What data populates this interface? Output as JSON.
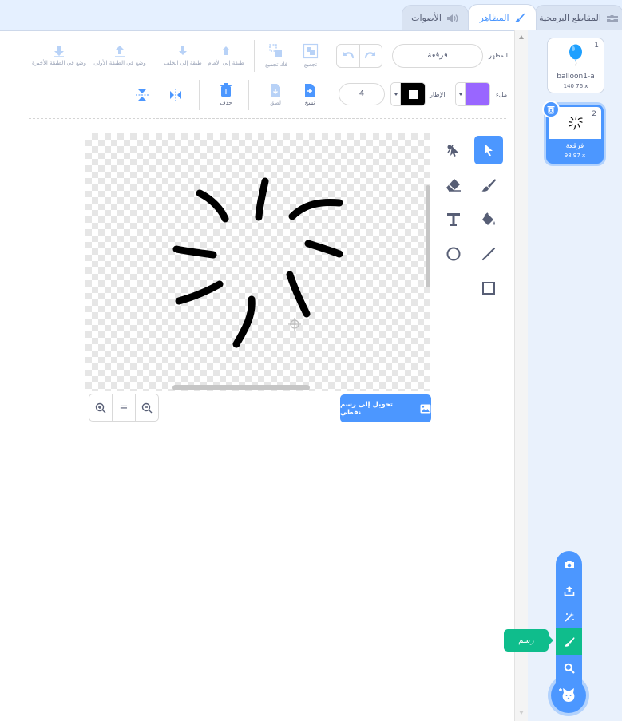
{
  "tabs": {
    "code": "المقاطع البرمجية",
    "costumes": "المظاهر",
    "sounds": "الأصوات"
  },
  "toolbar": {
    "costume_label": "المظهر",
    "costume_name": "فرقعة",
    "group": "تجميع",
    "ungroup": "فك تجميع",
    "forward": "طبقة إلى الأمام",
    "backward": "طبقة إلى الخلف",
    "front": "وضع في الطبقة الأولى",
    "back": "وضع في الطبقة الأخيرة",
    "fill_label": "ملء",
    "outline_label": "الإطار",
    "outline_width": "4",
    "copy": "نسخ",
    "paste": "لصق",
    "delete": "حذف",
    "fill_color": "#9966ff",
    "outline_color": "#000000"
  },
  "canvas": {
    "convert_button": "تحويل إلى رسم نقطي",
    "zoom_reset": "="
  },
  "costumes": [
    {
      "number": "1",
      "name": "balloon1-a",
      "size": "140 76 x"
    },
    {
      "number": "2",
      "name": "فرقعة",
      "size": "98 97 x"
    }
  ],
  "add_menu": {
    "tooltip": "رسم"
  }
}
